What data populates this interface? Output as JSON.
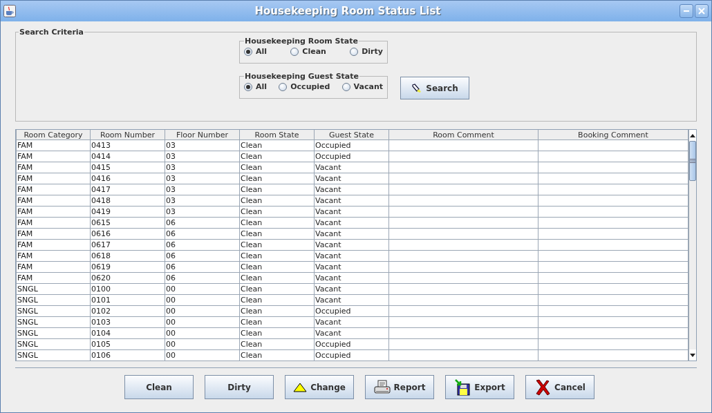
{
  "window": {
    "title": "Housekeeping Room Status List"
  },
  "search_criteria": {
    "title": "Search Criteria",
    "room_state": {
      "title": "Housekeeping Room State",
      "options": [
        {
          "label": "All",
          "selected": true
        },
        {
          "label": "Clean",
          "selected": false
        },
        {
          "label": "Dirty",
          "selected": false
        }
      ]
    },
    "guest_state": {
      "title": "Housekeeping Guest State",
      "options": [
        {
          "label": "All",
          "selected": true
        },
        {
          "label": "Occupied",
          "selected": false
        },
        {
          "label": "Vacant",
          "selected": false
        }
      ]
    },
    "search_button": "Search"
  },
  "table": {
    "columns": [
      "Room Category",
      "Room Number",
      "Floor Number",
      "Room State",
      "Guest State",
      "Room Comment",
      "Booking Comment"
    ],
    "rows": [
      [
        "FAM",
        "0413",
        "03",
        "Clean",
        "Occupied",
        "",
        ""
      ],
      [
        "FAM",
        "0414",
        "03",
        "Clean",
        "Occupied",
        "",
        ""
      ],
      [
        "FAM",
        "0415",
        "03",
        "Clean",
        "Vacant",
        "",
        ""
      ],
      [
        "FAM",
        "0416",
        "03",
        "Clean",
        "Vacant",
        "",
        ""
      ],
      [
        "FAM",
        "0417",
        "03",
        "Clean",
        "Vacant",
        "",
        ""
      ],
      [
        "FAM",
        "0418",
        "03",
        "Clean",
        "Vacant",
        "",
        ""
      ],
      [
        "FAM",
        "0419",
        "03",
        "Clean",
        "Vacant",
        "",
        ""
      ],
      [
        "FAM",
        "0615",
        "06",
        "Clean",
        "Vacant",
        "",
        ""
      ],
      [
        "FAM",
        "0616",
        "06",
        "Clean",
        "Vacant",
        "",
        ""
      ],
      [
        "FAM",
        "0617",
        "06",
        "Clean",
        "Vacant",
        "",
        ""
      ],
      [
        "FAM",
        "0618",
        "06",
        "Clean",
        "Vacant",
        "",
        ""
      ],
      [
        "FAM",
        "0619",
        "06",
        "Clean",
        "Vacant",
        "",
        ""
      ],
      [
        "FAM",
        "0620",
        "06",
        "Clean",
        "Vacant",
        "",
        ""
      ],
      [
        "SNGL",
        "0100",
        "00",
        "Clean",
        "Vacant",
        "",
        ""
      ],
      [
        "SNGL",
        "0101",
        "00",
        "Clean",
        "Vacant",
        "",
        ""
      ],
      [
        "SNGL",
        "0102",
        "00",
        "Clean",
        "Occupied",
        "",
        ""
      ],
      [
        "SNGL",
        "0103",
        "00",
        "Clean",
        "Vacant",
        "",
        ""
      ],
      [
        "SNGL",
        "0104",
        "00",
        "Clean",
        "Vacant",
        "",
        ""
      ],
      [
        "SNGL",
        "0105",
        "00",
        "Clean",
        "Occupied",
        "",
        ""
      ],
      [
        "SNGL",
        "0106",
        "00",
        "Clean",
        "Occupied",
        "",
        ""
      ]
    ]
  },
  "buttons": [
    {
      "label": "Clean",
      "kind": "plain"
    },
    {
      "label": "Dirty",
      "kind": "plain"
    },
    {
      "label": "Change",
      "kind": "change"
    },
    {
      "label": "Report",
      "kind": "report"
    },
    {
      "label": "Export",
      "kind": "export"
    },
    {
      "label": "Cancel",
      "kind": "cancel"
    }
  ]
}
